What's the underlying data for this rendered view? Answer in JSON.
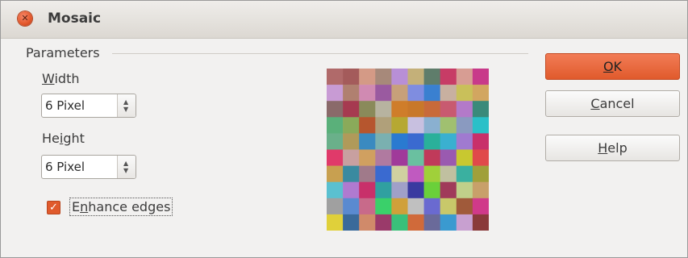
{
  "window": {
    "title": "Mosaic"
  },
  "parameters": {
    "section_label": "Parameters",
    "width": {
      "label_mnemonic": "W",
      "label_rest": "idth",
      "value": "6 Pixel"
    },
    "height": {
      "label_pre": "He",
      "label_mnemonic": "i",
      "label_post": "ght",
      "value": "6 Pixel"
    },
    "enhance_edges": {
      "checked": true,
      "label_pre": "E",
      "label_mnemonic": "n",
      "label_post": "hance edges"
    }
  },
  "buttons": {
    "ok": {
      "mnemonic": "O",
      "rest": "K"
    },
    "cancel": {
      "mnemonic": "C",
      "rest": "ancel"
    },
    "help": {
      "mnemonic": "H",
      "rest": "elp"
    }
  },
  "colors": {
    "accent": "#e05a2c",
    "preview_tiles": [
      [
        "#b06a6a",
        "#a45b5b",
        "#d49a86",
        "#a7897a",
        "#b88fd6",
        "#c4b079",
        "#5f7d6b",
        "#c73c66",
        "#d79d93",
        "#c83a8a"
      ],
      [
        "#c89bd4",
        "#b08070",
        "#d08ab2",
        "#9a5aa0",
        "#c7a07a",
        "#7f8de0",
        "#3a80d0",
        "#c8b0a0",
        "#c9c05a",
        "#d2a660"
      ],
      [
        "#8a6a6a",
        "#a63a50",
        "#8a8a5a",
        "#b7b3a0",
        "#cf7d2a",
        "#c8782a",
        "#c86a3a",
        "#c85a70",
        "#b37ac9",
        "#3a8a7a"
      ],
      [
        "#5ab07a",
        "#8aaa5a",
        "#b6562e",
        "#b0a07a",
        "#b6a832",
        "#c8c0e0",
        "#8ab0d0",
        "#a0c070",
        "#8a9ac0",
        "#2ac0c8"
      ],
      [
        "#6ab08a",
        "#b09a5a",
        "#3a8ac0",
        "#7ab0b0",
        "#2a7ad0",
        "#3a6ad0",
        "#2ab09a",
        "#3ab0d0",
        "#a07ad0",
        "#c8306a"
      ],
      [
        "#e03a6a",
        "#c8a0a0",
        "#d0a060",
        "#b07aa0",
        "#a03a9a",
        "#6ac0a0",
        "#c03a5a",
        "#9a5ab0",
        "#c8c830",
        "#e04a4a"
      ],
      [
        "#c8a050",
        "#3a8aa0",
        "#a07a8a",
        "#3a6ad0",
        "#d0d0a0",
        "#c05ac0",
        "#a0d03a",
        "#c0c0a0",
        "#3ab0a0",
        "#a0a03a"
      ],
      [
        "#5ac0d0",
        "#b07ad0",
        "#c8306a",
        "#30a0a0",
        "#a0a0c8",
        "#3a3aa0",
        "#6ad03a",
        "#a03a5a",
        "#c0d08a",
        "#c8a06a"
      ],
      [
        "#a0a0a0",
        "#5a8ad0",
        "#c86a8a",
        "#3ad06a",
        "#d0a03a",
        "#c0c0c0",
        "#6a6ad0",
        "#c8c86a",
        "#a05a3a",
        "#d03a8a"
      ],
      [
        "#e0d03a",
        "#3a6a9a",
        "#d08a6a",
        "#9a3a6a",
        "#3ac07a",
        "#d06a3a",
        "#6a6a9a",
        "#3a9ad0",
        "#c8a0d0",
        "#8a3a3a"
      ]
    ]
  }
}
